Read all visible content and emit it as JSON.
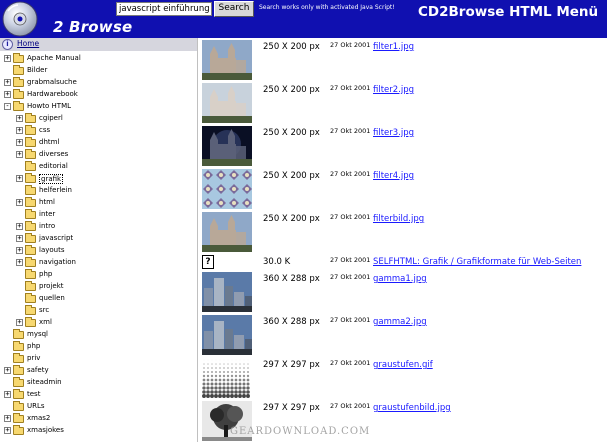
{
  "header": {
    "brand": "2 Browse",
    "title": "CD2Browse HTML Menü",
    "search_value": "javascript einführung",
    "search_button": "Search",
    "search_note": "Search works only with activated Java Script!",
    "bg_color": "#1010b0"
  },
  "sidebar": {
    "home_label": "Home",
    "items": [
      {
        "label": "Apache Manual",
        "expand": "+",
        "level": 0
      },
      {
        "label": "Bilder",
        "expand": "",
        "level": 0
      },
      {
        "label": "grabmalsuche",
        "expand": "+",
        "level": 0
      },
      {
        "label": "Hardwarebook",
        "expand": "+",
        "level": 0
      },
      {
        "label": "Howto HTML",
        "expand": "-",
        "level": 0
      },
      {
        "label": "cgiperl",
        "expand": "+",
        "level": 1
      },
      {
        "label": "css",
        "expand": "+",
        "level": 1
      },
      {
        "label": "dhtml",
        "expand": "+",
        "level": 1
      },
      {
        "label": "diverses",
        "expand": "+",
        "level": 1
      },
      {
        "label": "editorial",
        "expand": "",
        "level": 1
      },
      {
        "label": "grafik",
        "expand": "+",
        "level": 1,
        "selected": true
      },
      {
        "label": "helferlein",
        "expand": "",
        "level": 1
      },
      {
        "label": "html",
        "expand": "+",
        "level": 1
      },
      {
        "label": "inter",
        "expand": "",
        "level": 1
      },
      {
        "label": "intro",
        "expand": "+",
        "level": 1
      },
      {
        "label": "javascript",
        "expand": "+",
        "level": 1
      },
      {
        "label": "layouts",
        "expand": "+",
        "level": 1
      },
      {
        "label": "navigation",
        "expand": "+",
        "level": 1
      },
      {
        "label": "php",
        "expand": "",
        "level": 1
      },
      {
        "label": "projekt",
        "expand": "",
        "level": 1
      },
      {
        "label": "quellen",
        "expand": "",
        "level": 1
      },
      {
        "label": "src",
        "expand": "",
        "level": 1
      },
      {
        "label": "xml",
        "expand": "+",
        "level": 1
      },
      {
        "label": "mysql",
        "expand": "",
        "level": 0
      },
      {
        "label": "php",
        "expand": "",
        "level": 0
      },
      {
        "label": "priv",
        "expand": "",
        "level": 0
      },
      {
        "label": "safety",
        "expand": "+",
        "level": 0
      },
      {
        "label": "siteadmin",
        "expand": "",
        "level": 0
      },
      {
        "label": "test",
        "expand": "+",
        "level": 0
      },
      {
        "label": "URLs",
        "expand": "",
        "level": 0
      },
      {
        "label": "xmas2",
        "expand": "+",
        "level": 0
      },
      {
        "label": "xmasjokes",
        "expand": "+",
        "level": 0
      }
    ]
  },
  "files": [
    {
      "thumb": "castle",
      "size": "250 X 200 px",
      "date": "27 Okt 2001",
      "name": "filter1.jpg"
    },
    {
      "thumb": "castle-light",
      "size": "250 X 200 px",
      "date": "27 Okt 2001",
      "name": "filter2.jpg"
    },
    {
      "thumb": "castle-dark",
      "size": "250 X 200 px",
      "date": "27 Okt 2001",
      "name": "filter3.jpg"
    },
    {
      "thumb": "kaleido",
      "size": "250 X 200 px",
      "date": "27 Okt 2001",
      "name": "filter4.jpg"
    },
    {
      "thumb": "castle",
      "size": "250 X 200 px",
      "date": "27 Okt 2001",
      "name": "filterbild.jpg"
    },
    {
      "thumb": "unknown",
      "size": "30.0 K",
      "date": "27 Okt 2001",
      "name": "SELFHTML: Grafik / Grafikformate für Web-Seiten"
    },
    {
      "thumb": "city",
      "size": "360 X 288 px",
      "date": "27 Okt 2001",
      "name": "gamma1.jpg"
    },
    {
      "thumb": "city",
      "size": "360 X 288 px",
      "date": "27 Okt 2001",
      "name": "gamma2.jpg"
    },
    {
      "thumb": "gradient",
      "size": "297 X 297 px",
      "date": "27 Okt 2001",
      "name": "graustufen.gif"
    },
    {
      "thumb": "tree",
      "size": "297 X 297 px",
      "date": "27 Okt 2001",
      "name": "graustufenbild.jpg"
    }
  ],
  "watermark": "GEARDOWNLOAD.COM",
  "link_color": "#1a1aff"
}
